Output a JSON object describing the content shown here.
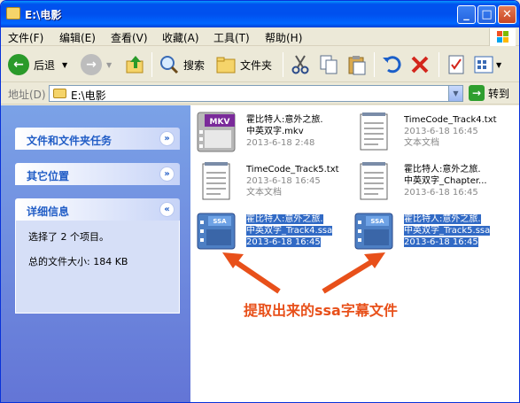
{
  "window": {
    "title": "E:\\电影"
  },
  "title_buttons": {
    "minimize": "_",
    "maximize": "□",
    "close": "✕"
  },
  "menu": [
    "文件(F)",
    "编辑(E)",
    "查看(V)",
    "收藏(A)",
    "工具(T)",
    "帮助(H)"
  ],
  "toolbar": {
    "back_label": "后退",
    "search_label": "搜索",
    "folders_label": "文件夹"
  },
  "address": {
    "label": "地址(D)",
    "value": "E:\\电影",
    "go_label": "转到"
  },
  "left_panels": {
    "tasks": "文件和文件夹任务",
    "places": "其它位置",
    "details": {
      "title": "详细信息",
      "line1": "选择了 2 个项目。",
      "line2": "总的文件大小: 184 KB"
    }
  },
  "files": [
    {
      "name": "霍比特人:意外之旅.",
      "name2": "中英双字.mkv",
      "meta": "2013-6-18 2:48",
      "type": "mkv",
      "selected": false
    },
    {
      "name": "TimeCode_Track4.txt",
      "name2": "2013-6-18 16:45",
      "meta": "文本文档",
      "type": "txt",
      "selected": false
    },
    {
      "name": "TimeCode_Track5.txt",
      "name2": "2013-6-18 16:45",
      "meta": "文本文档",
      "type": "txt",
      "selected": false
    },
    {
      "name": "霍比特人:意外之旅.",
      "name2": "中英双字_Chapter...",
      "meta": "2013-6-18 16:45",
      "type": "txt",
      "selected": false
    },
    {
      "name": "霍比特人:意外之旅.",
      "name2": "中英双字_Track4.ssa",
      "meta": "2013-6-18 16:45",
      "type": "ssa",
      "selected": true
    },
    {
      "name": "霍比特人:意外之旅.",
      "name2": "中英双字_Track5.ssa",
      "meta": "2013-6-18 16:45",
      "type": "ssa",
      "selected": true
    }
  ],
  "icons": {
    "mkv_badge": "MKV",
    "ssa_badge": "SSA"
  },
  "annotation": "提取出来的ssa字幕文件",
  "colors": {
    "title_blue": "#0053ee",
    "selection": "#316ac5",
    "annotation": "#e8501a",
    "task_pane": "#7ba2e7"
  }
}
